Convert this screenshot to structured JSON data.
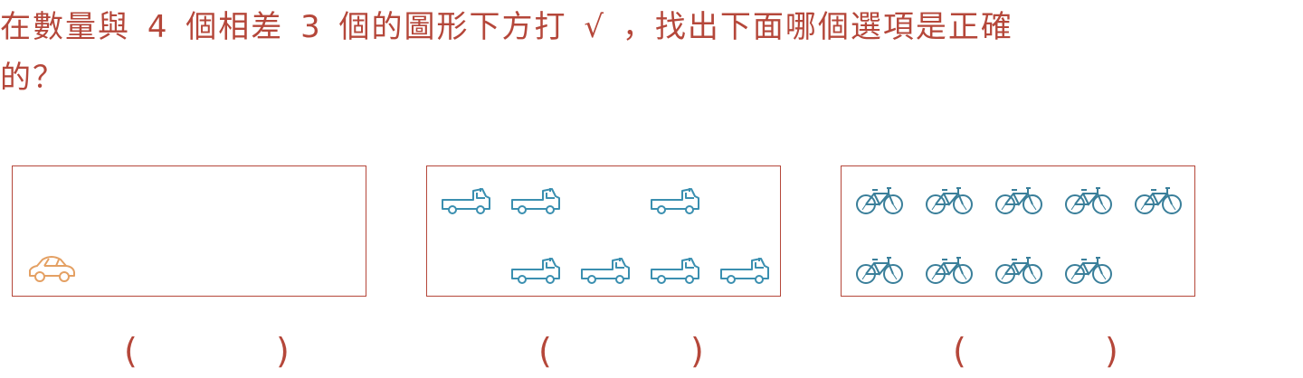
{
  "question": {
    "part1": "在數量與",
    "num_a": "4",
    "part2": "個相差",
    "num_b": "3",
    "part3": "個的圖形下方打",
    "check": "√",
    "part4": "，找出下面哪個選項是正確",
    "part5": "的？"
  },
  "options": [
    {
      "item": "car-icon",
      "count": 1,
      "color": "#e4a063",
      "answer_left": "(",
      "answer_right": ")"
    },
    {
      "item": "truck-icon",
      "count": 7,
      "color": "#3a8fb0",
      "answer_left": "(",
      "answer_right": ")"
    },
    {
      "item": "bicycle-icon",
      "count": 9,
      "color": "#3a7f9a",
      "answer_left": "(",
      "answer_right": ")"
    }
  ],
  "colors": {
    "text": "#b5473a",
    "border": "#b5473a"
  }
}
